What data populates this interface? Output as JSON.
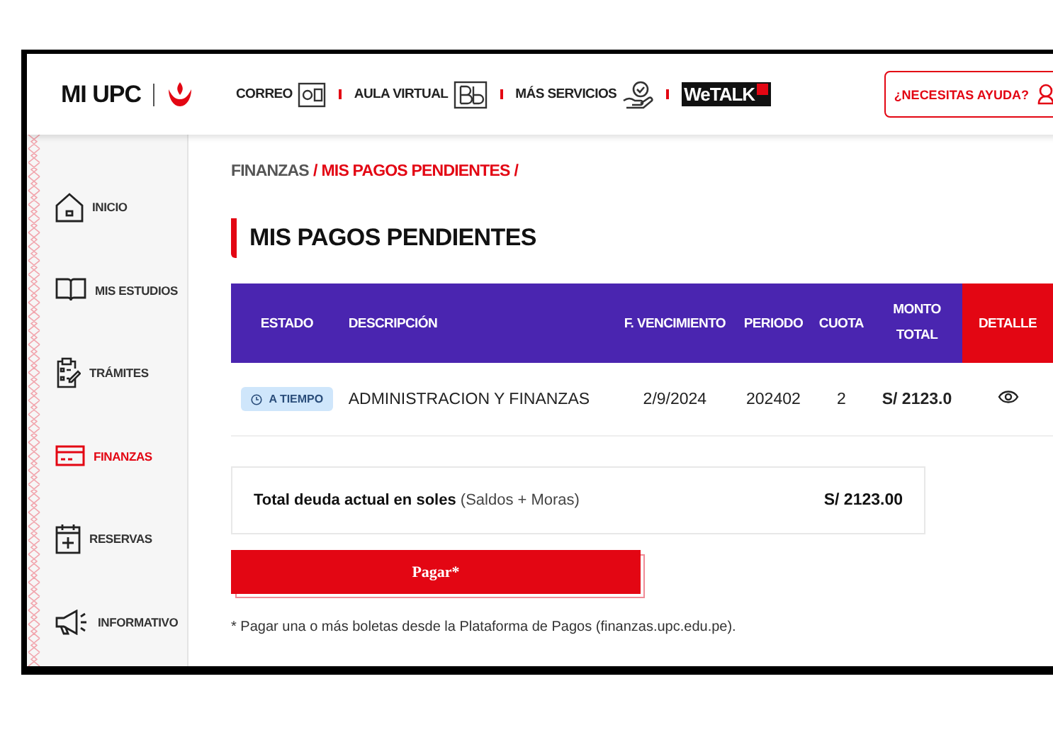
{
  "header": {
    "logo": "MI UPC",
    "nav": [
      {
        "label": "CORREO"
      },
      {
        "label": "AULA VIRTUAL"
      },
      {
        "label": "MÁS SERVICIOS"
      }
    ],
    "wetalk": {
      "we": "We",
      "talk": "TALK"
    },
    "help": "¿NECESITAS AYUDA?"
  },
  "sidebar": {
    "items": [
      {
        "label": "INICIO",
        "selected": false
      },
      {
        "label": "MIS ESTUDIOS",
        "selected": false
      },
      {
        "label": "TRÁMITES",
        "selected": false
      },
      {
        "label": "FINANZAS",
        "selected": true
      },
      {
        "label": "RESERVAS",
        "selected": false
      },
      {
        "label": "INFORMATIVO",
        "selected": false
      }
    ]
  },
  "breadcrumb": [
    {
      "label": "FINANZAS",
      "separator": "/"
    },
    {
      "label": "MIS PAGOS PENDIENTES",
      "separator": "/"
    }
  ],
  "title": "MIS PAGOS PENDIENTES",
  "table": {
    "columns": [
      "ESTADO",
      "DESCRIPCIÓN",
      "F. VENCIMIENTO",
      "PERIODO",
      "CUOTA",
      "MONTO TOTAL",
      "DETALLE"
    ],
    "rows": [
      {
        "estado": "A TIEMPO",
        "descripcion": "ADMINISTRACION Y FINANZAS",
        "vencimiento": "2/9/2024",
        "periodo": "202402",
        "cuota": "2",
        "monto": "S/ 2123.0"
      }
    ]
  },
  "total": {
    "label": "**Total deuda actual en soles** (Saldos + Moras)",
    "amount": "S/ 2123.00"
  },
  "pay_button": "Pagar*",
  "footnote": "* Pagar una o más boletas desde la Plataforma de Pagos (finanzas.upc.edu.pe)."
}
